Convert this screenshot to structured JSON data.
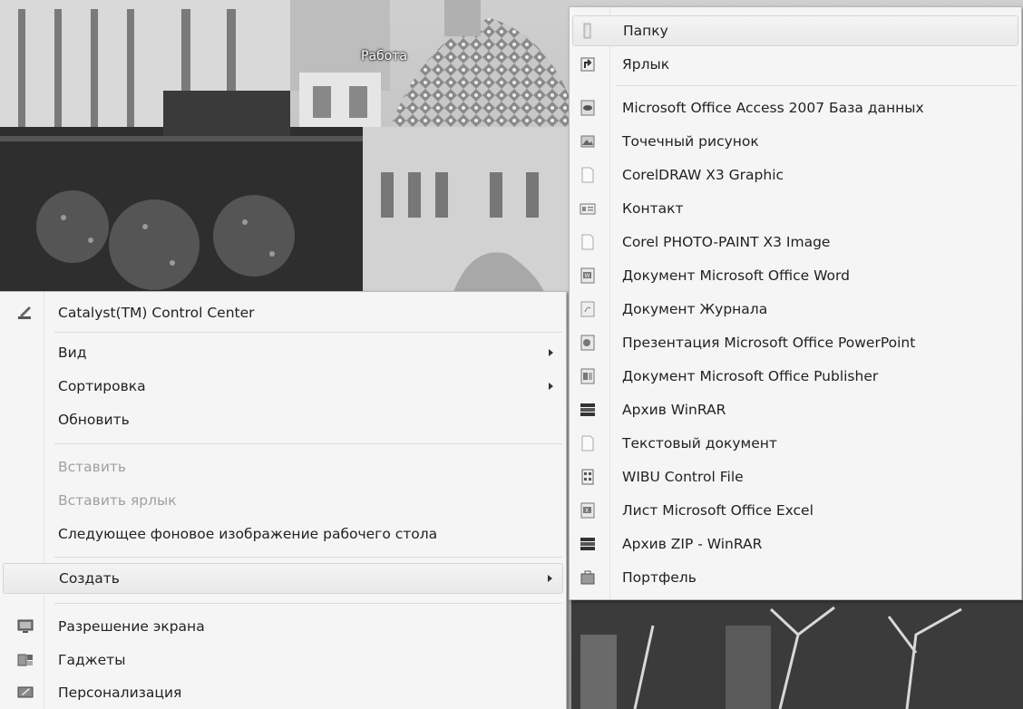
{
  "desktop": {
    "folder_label": "Работа"
  },
  "main_menu": {
    "items": [
      {
        "label": "Catalyst(TM) Control Center",
        "icon": "catalyst-icon"
      },
      {
        "label": "Вид",
        "submenu": true
      },
      {
        "label": "Сортировка",
        "submenu": true
      },
      {
        "label": "Обновить"
      },
      {
        "label": "Вставить",
        "disabled": true
      },
      {
        "label": "Вставить ярлык",
        "disabled": true
      },
      {
        "label": "Следующее фоновое изображение рабочего стола"
      },
      {
        "label": "Создать",
        "submenu": true,
        "highlighted": true
      },
      {
        "label": "Разрешение экрана",
        "icon": "screen-resolution-icon"
      },
      {
        "label": "Гаджеты",
        "icon": "gadgets-icon"
      },
      {
        "label": "Персонализация",
        "icon": "personalization-icon"
      }
    ]
  },
  "sub_menu": {
    "items": [
      {
        "label": "Папку",
        "icon": "folder-icon",
        "highlighted": true
      },
      {
        "label": "Ярлык",
        "icon": "shortcut-icon"
      },
      {
        "label": "Microsoft Office Access 2007 База данных",
        "icon": "access-icon"
      },
      {
        "label": "Точечный рисунок",
        "icon": "bitmap-icon"
      },
      {
        "label": "CorelDRAW X3 Graphic",
        "icon": "coreldraw-icon"
      },
      {
        "label": "Контакт",
        "icon": "contact-icon"
      },
      {
        "label": "Corel PHOTO-PAINT X3 Image",
        "icon": "photopaint-icon"
      },
      {
        "label": "Документ Microsoft Office Word",
        "icon": "word-icon"
      },
      {
        "label": "Документ Журнала",
        "icon": "journal-icon"
      },
      {
        "label": "Презентация Microsoft Office PowerPoint",
        "icon": "powerpoint-icon"
      },
      {
        "label": "Документ Microsoft Office Publisher",
        "icon": "publisher-icon"
      },
      {
        "label": "Архив WinRAR",
        "icon": "winrar-icon"
      },
      {
        "label": "Текстовый документ",
        "icon": "text-document-icon"
      },
      {
        "label": "WIBU Control File",
        "icon": "wibu-icon"
      },
      {
        "label": "Лист Microsoft Office Excel",
        "icon": "excel-icon"
      },
      {
        "label": "Архив ZIP - WinRAR",
        "icon": "zip-winrar-icon"
      },
      {
        "label": "Портфель",
        "icon": "briefcase-icon"
      }
    ]
  }
}
